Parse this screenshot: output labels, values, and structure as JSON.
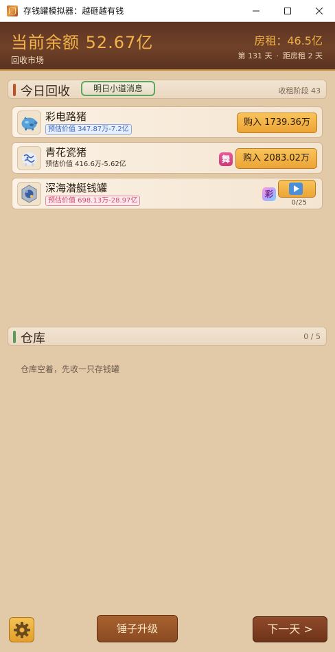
{
  "window": {
    "title": "存钱罐模拟器：越砸越有钱",
    "minimize_glyph": "minimize-icon",
    "maximize_glyph": "maximize-icon",
    "close_glyph": "close-icon"
  },
  "header": {
    "balance": "当前余额 52.67亿",
    "subtitle": "回收市场",
    "rent": "房租：46.5亿",
    "day": "第 131 天",
    "dot": "·",
    "rent_countdown": "距房租 2 天"
  },
  "recycle": {
    "title": "今日回收",
    "tip_button": "明日小道消息",
    "stage": "收租阶段 43",
    "accent": "#c0502a",
    "items": [
      {
        "name": "彩电路猪",
        "estimate": "预估价值 347.87万-7.2亿",
        "estimate_style": "blue",
        "action": "购入 1739.36万",
        "icon": "rainbow-pig-icon"
      },
      {
        "name": "青花瓷猪",
        "estimate": "预估价值 416.6万-5.62亿",
        "estimate_style": "plain",
        "badge": "舞",
        "action": "购入 2083.02万",
        "icon": "porcelain-pig-icon"
      },
      {
        "name": "深海潜艇钱罐",
        "estimate": "预估价值 698.13万-28.97亿",
        "estimate_style": "red",
        "badge": "彩",
        "play_count": "0/25",
        "icon": "submarine-bank-icon"
      }
    ]
  },
  "warehouse": {
    "title": "仓库",
    "capacity": "0 / 5",
    "accent": "#5a9a5a",
    "empty_text": "仓库空着，先收一只存钱罐"
  },
  "footer": {
    "settings_icon": "gear-icon",
    "hammer_button": "锤子升级",
    "next_button": "下一天  >"
  }
}
